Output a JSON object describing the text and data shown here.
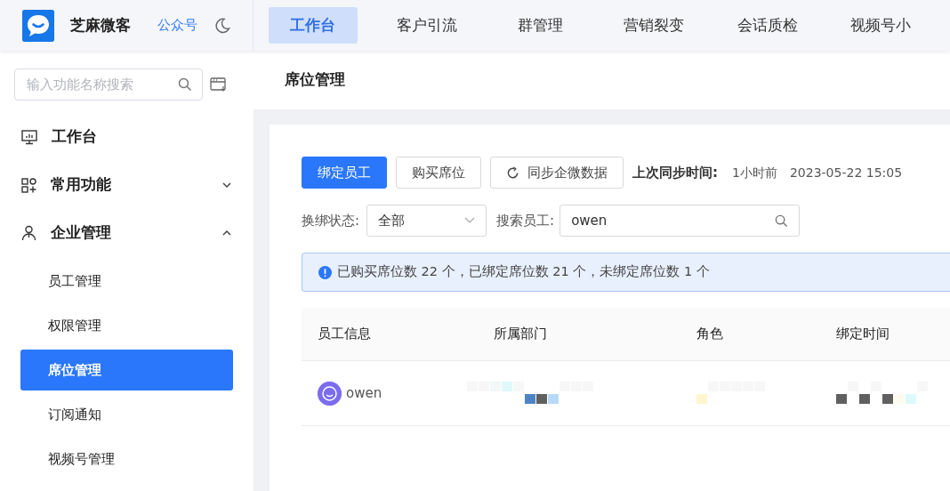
{
  "brand": {
    "name": "芝麻微客",
    "link": "公众号"
  },
  "top_tabs": [
    {
      "label": "工作台",
      "selected": true
    },
    {
      "label": "客户引流",
      "selected": false
    },
    {
      "label": "群管理",
      "selected": false
    },
    {
      "label": "营销裂变",
      "selected": false
    },
    {
      "label": "会话质检",
      "selected": false
    },
    {
      "label": "视频号小",
      "selected": false
    }
  ],
  "sidebar": {
    "search": {
      "placeholder": "输入功能名称搜索"
    },
    "items": [
      {
        "kind": "link",
        "label": "工作台",
        "selected": false
      },
      {
        "kind": "group",
        "label": "常用功能",
        "expanded": false
      },
      {
        "kind": "group",
        "label": "企业管理",
        "expanded": true,
        "children": [
          {
            "label": "员工管理",
            "selected": false
          },
          {
            "label": "权限管理",
            "selected": false
          },
          {
            "label": "席位管理",
            "selected": true
          },
          {
            "label": "订阅通知",
            "selected": false
          },
          {
            "label": "视频号管理",
            "selected": false
          }
        ]
      }
    ]
  },
  "page_title": "席位管理",
  "toolbar": {
    "buttons": [
      {
        "label": "绑定员工",
        "primary": true
      },
      {
        "label": "购买席位",
        "primary": false
      },
      {
        "label": "同步企微数据",
        "primary": false
      }
    ],
    "sync_label": "上次同步时间:",
    "sync_ago": "1小时前",
    "sync_time": "2023-05-22 15:05"
  },
  "filters": {
    "status_label": "换绑状态:",
    "status_value": "全部",
    "search_label": "搜索员工:",
    "search_value": "owen"
  },
  "alert": "已购买席位数 22 个，已绑定席位数 21 个，未绑定席位数 1 个",
  "table": {
    "columns": [
      "员工信息",
      "所属部门",
      "角色",
      "绑定时间"
    ],
    "rows": [
      {
        "name": "owen"
      }
    ]
  }
}
